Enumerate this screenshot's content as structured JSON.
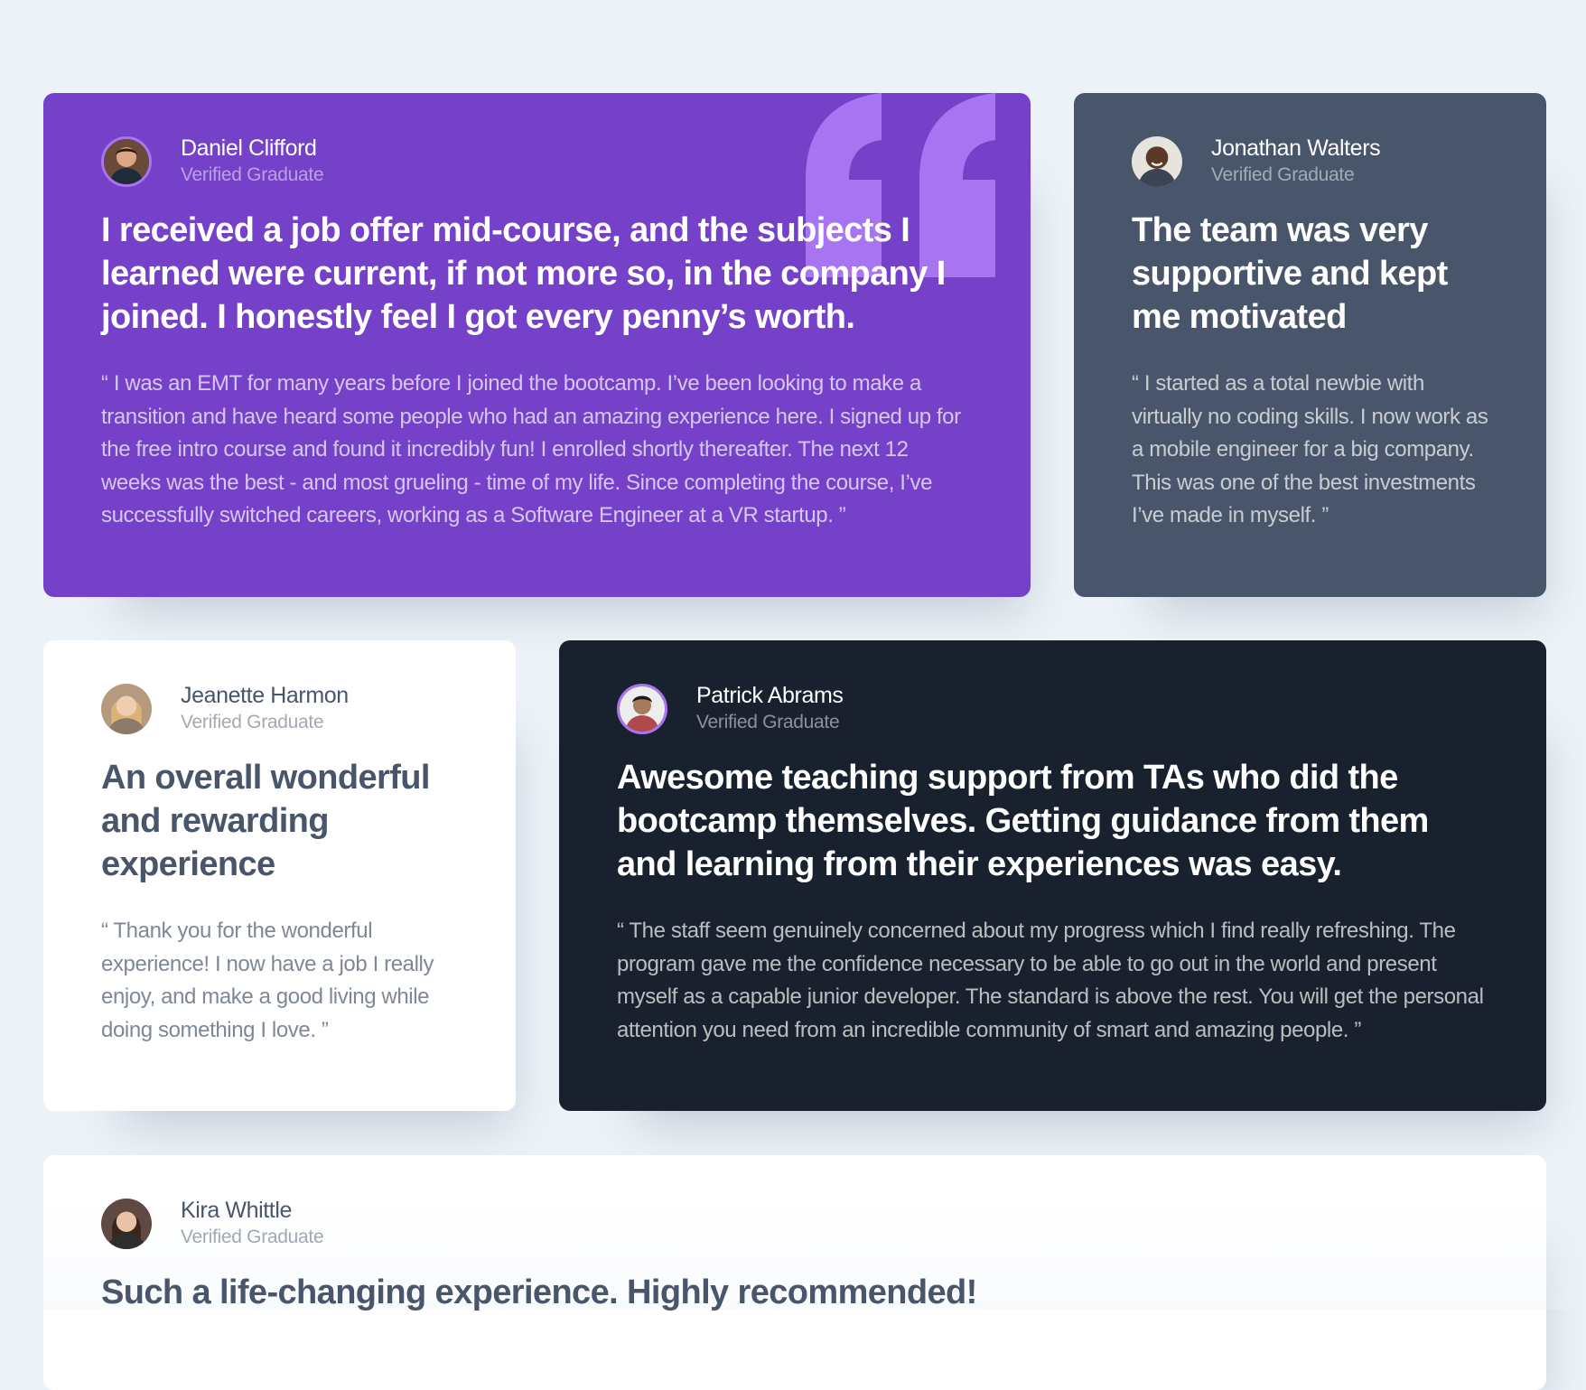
{
  "colors": {
    "background": "#ECF2F8",
    "purple": "#7541C8",
    "slate": "#48556A",
    "dark": "#19212E",
    "white": "#FFFFFF",
    "accent_ring": "#A775F1"
  },
  "testimonials": [
    {
      "name": "Daniel Clifford",
      "role": "Verified Graduate",
      "avatar_icon": "daniel-avatar-icon",
      "headline": "I received a job offer mid-course, and the subjects I learned were current, if not more so, in the company I joined. I honestly feel I got every penny’s worth.",
      "quote": "“ I was an EMT for many years before I joined the bootcamp. I’ve been looking to make a transition and have heard some people who had an amazing experience here. I signed up for the free intro course and found it incredibly fun! I enrolled shortly thereafter. The next 12 weeks was the best - and most grueling - time of my life. Since completing the course, I’ve successfully switched careers, working as a Software Engineer at a VR startup. ”"
    },
    {
      "name": "Jonathan Walters",
      "role": "Verified Graduate",
      "avatar_icon": "jonathan-avatar-icon",
      "headline": "The team was very supportive and kept me motivated",
      "quote": "“ I started as a total newbie with virtually no coding skills. I now work as a mobile engineer for a big company. This was one of the best investments I’ve made in myself. ”"
    },
    {
      "name": "Jeanette Harmon",
      "role": "Verified Graduate",
      "avatar_icon": "jeanette-avatar-icon",
      "headline": "An overall wonderful and rewarding experience",
      "quote": "“ Thank you for the wonderful experience! I now have a job I really enjoy, and make a good living while doing something I love. ”"
    },
    {
      "name": "Patrick Abrams",
      "role": "Verified Graduate",
      "avatar_icon": "patrick-avatar-icon",
      "headline": "Awesome teaching support from TAs who did the bootcamp themselves. Getting guidance from them and learning from their experiences was easy.",
      "quote": "“ The staff seem genuinely concerned about my progress which I find really refreshing. The program gave me the confidence necessary to be able to go out in the world and present myself as a capable junior developer. The standard is above the rest. You will get the personal attention you need from an incredible community of smart and amazing people. ”"
    },
    {
      "name": "Kira Whittle",
      "role": "Verified Graduate",
      "avatar_icon": "kira-avatar-icon",
      "headline": "Such a life-changing experience. Highly recommended!"
    }
  ]
}
